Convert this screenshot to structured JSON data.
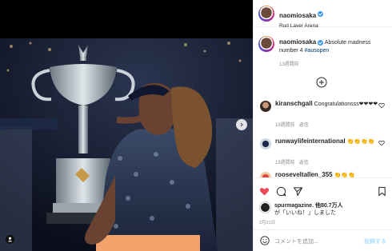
{
  "post": {
    "author": "naomiosaka",
    "verified": true,
    "location": "Rod Laver Arena"
  },
  "caption": {
    "author": "naomiosaka",
    "text": "Absolute madness number 4",
    "hashtag": "#ausopen",
    "time": "13週間前"
  },
  "comments": [
    {
      "user": "kiranschgall",
      "text": "Congratulationsss❤❤❤❤",
      "time": "13週間前",
      "reply_label": "返信"
    },
    {
      "user": "runwaylifeinternational",
      "text": "👏👏👏👏",
      "time": "13週間前",
      "reply_label": "返信"
    },
    {
      "user": "rooseveltallen_355",
      "text": "👏👏👏",
      "time": "",
      "reply_label": ""
    }
  ],
  "likes": {
    "avatar_user": "spurmagazine",
    "line1_user": "spurmagazine.",
    "line1_rest": "他80.7万人",
    "line2": "が「いいね！」しました"
  },
  "date": "2月21日",
  "comment_input": {
    "placeholder": "コメントを追加...",
    "post_label": "投稿する"
  },
  "colors": {
    "like_red": "#ed4956",
    "link_blue": "#3897f0",
    "hashtag": "#00376b",
    "muted": "#8e8e8e"
  },
  "icons": [
    "heart-icon",
    "comment-icon",
    "share-icon",
    "bookmark-icon",
    "emoji-icon",
    "chevron-right-icon",
    "user-tag-icon",
    "load-more-icon",
    "like-comment-icon",
    "verified-badge-icon"
  ]
}
